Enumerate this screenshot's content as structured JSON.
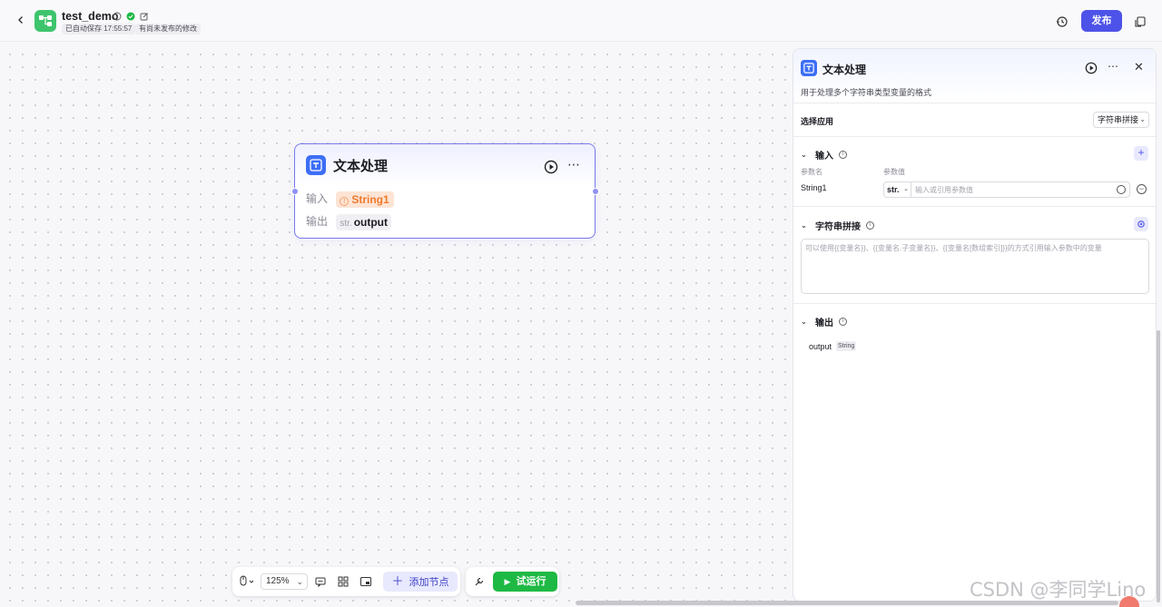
{
  "header": {
    "back_icon": "chevron-left-icon",
    "app_name": "test_demo",
    "autosave_tag": "已自动保存 17:55:57",
    "unpublished_tag": "有尚未发布的修改",
    "publish_label": "发布",
    "accent_color": "#4d53e8"
  },
  "node": {
    "title": "文本处理",
    "input_label": "输入",
    "input_value": "String1",
    "output_label": "输出",
    "output_type": "str.",
    "output_value": "output"
  },
  "toolbar": {
    "zoom": "125%",
    "add_node_label": "添加节点",
    "trial_run_label": "试运行",
    "trial_color": "#1eb944"
  },
  "panel": {
    "title": "文本处理",
    "description": "用于处理多个字符串类型变量的格式",
    "select_app_label": "选择应用",
    "select_app_value": "字符串拼接",
    "input_section": "输入",
    "col_param_name": "参数名",
    "col_param_value": "参数值",
    "param_name": "String1",
    "param_type": "str.",
    "param_placeholder": "输入或引用参数值",
    "concat_section": "字符串拼接",
    "template_placeholder": "可以使用{{变量名}}、{{变量名.子变量名}}、{{变量名[数组索引]}}的方式引用输入参数中的变量",
    "output_section": "输出",
    "output_name": "output",
    "output_type": "String"
  },
  "watermark": "CSDN @李同学Lino"
}
